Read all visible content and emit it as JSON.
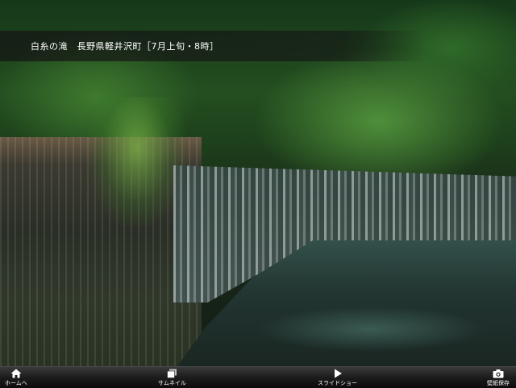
{
  "caption": {
    "text": "白糸の滝　長野県軽井沢町［7月上旬・8時］"
  },
  "toolbar": {
    "items": [
      {
        "label": "ホームへ",
        "icon": "home-icon"
      },
      {
        "label": "サムネイル",
        "icon": "thumbnails-icon"
      },
      {
        "label": "スライドショー",
        "icon": "play-icon"
      },
      {
        "label": "壁紙保存",
        "icon": "save-wallpaper-icon"
      }
    ]
  },
  "colors": {
    "toolbar_bg": "#1c1c1c",
    "caption_bg": "#141414",
    "text": "#ffffff"
  }
}
